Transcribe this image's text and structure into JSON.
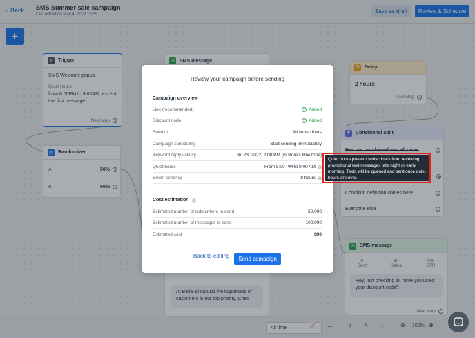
{
  "header": {
    "back_label": "Back",
    "title": "SMS Summer sale campaign",
    "subtitle": "Last edited on May 4, 2022 15:55",
    "save_draft_label": "Save as draft",
    "review_label": "Review & Schedule"
  },
  "canvas": {
    "add_label": "+",
    "trigger": {
      "title": "Trigger",
      "name": "SMS Welcome popup",
      "quiet_hours_label": "Quiet hours",
      "quiet_hours_value": "from 8:00PM to 9:00AM, except the first message",
      "next_step": "Next step"
    },
    "randomizer": {
      "title": "Randomizer",
      "variants": [
        {
          "label": "A",
          "value": "50%"
        },
        {
          "label": "B",
          "value": "50%"
        }
      ]
    },
    "sms_message": {
      "title": "SMS message",
      "bubble": "At Bella all natural the happiness of customers is our top priority. Chec"
    },
    "delay": {
      "title": "Delay",
      "value": "2 hours",
      "next_step": "Next step"
    },
    "conditional_split": {
      "title": "Conditional split",
      "conditions": [
        {
          "label": "Has not purchased and all order"
        },
        {
          "label": "Condition definition comes here"
        },
        {
          "label": "Everyone else"
        }
      ]
    },
    "sms_message_2": {
      "title": "SMS message",
      "stats": [
        {
          "value": "0",
          "label": "Sent"
        },
        {
          "value": "$0",
          "label": "Sales"
        },
        {
          "value": "0%",
          "label": "CTR"
        }
      ],
      "bubble": "Hey, just checking in, have you used your discount code?",
      "next_step": "Next step"
    }
  },
  "toolbar": {
    "time_filter": "All time",
    "more_label": "…",
    "zoom": "100%"
  },
  "modal": {
    "title": "Review your campaign before sending",
    "overview_title": "Campaign overview",
    "overview_rows": [
      {
        "label": "Link (recommended)",
        "value": "Added",
        "status": "added"
      },
      {
        "label": "Discount code",
        "value": "Added",
        "status": "added"
      },
      {
        "label": "Send to",
        "value": "All subscribers"
      },
      {
        "label": "Campaign scheduling",
        "value": "Start sending immediately"
      },
      {
        "label": "Keyword reply validity",
        "value": "Jul 23, 2022, 2:00 PM (in store's timezone)"
      },
      {
        "label": "Quiet hours",
        "value": "From 8:00 PM to 9:00 AM",
        "info": "i"
      },
      {
        "label": "Smart sending",
        "value": "8 hours",
        "info": "i"
      }
    ],
    "cost_title": "Cost estimation",
    "cost_info": "i",
    "cost_rows": [
      {
        "label": "Estimated number of subscribers to send",
        "value": "50.000"
      },
      {
        "label": "Estimated number of messages to send",
        "value": "100.000"
      },
      {
        "label": "Estimated cost",
        "value": "$90"
      }
    ],
    "back_label": "Back to editing",
    "send_label": "Send campaign"
  },
  "tooltip": {
    "text": "Quiet hours prevent subscribers from receiving promotional text messages late night or early morning. Texts will be queued and sent once quiet hours are over."
  },
  "colors": {
    "primary": "#1a73e8",
    "success": "#2e9e48",
    "highlight": "#e0241a",
    "tooltip_bg": "#232c36"
  }
}
